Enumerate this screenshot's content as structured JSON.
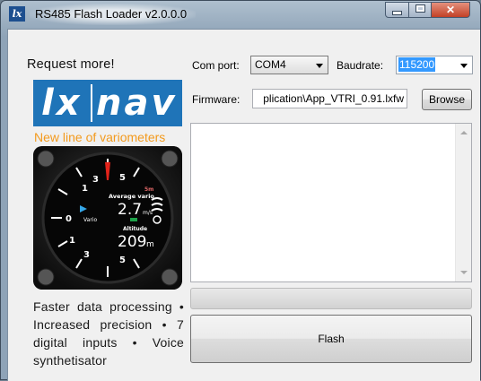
{
  "window": {
    "title": "RS485 Flash Loader v2.0.0.0",
    "app_icon": "lx"
  },
  "left_panel": {
    "request_text": "Request more!",
    "logo": {
      "left": "lx",
      "right": "nav"
    },
    "tagline": "New line of variometers",
    "device_display": {
      "ticks": [
        "1",
        "3",
        "5",
        "0",
        "1",
        "3",
        "5"
      ],
      "average_vario_label": "Average vario",
      "average_vario_value": "2.7",
      "average_vario_unit": "m/s",
      "vario_label": "Vario",
      "altitude_label": "Altitude",
      "altitude_value": "209",
      "altitude_unit": "m",
      "scale_top": "5m"
    },
    "features_text": "Faster data processing • Increased precision • 7 digital inputs • Voice synthetisator"
  },
  "form": {
    "com_port_label": "Com port:",
    "com_port_value": "COM4",
    "baudrate_label": "Baudrate:",
    "baudrate_value": "115200",
    "firmware_label": "Firmware:",
    "firmware_value": "plication\\App_VTRI_0.91.lxfw",
    "browse_label": "Browse",
    "flash_label": "Flash",
    "progress_fraction": 0
  },
  "colors": {
    "logo_blue": "#1f74b8",
    "tagline_orange": "#f39a1d",
    "selection": "#3399ff"
  }
}
